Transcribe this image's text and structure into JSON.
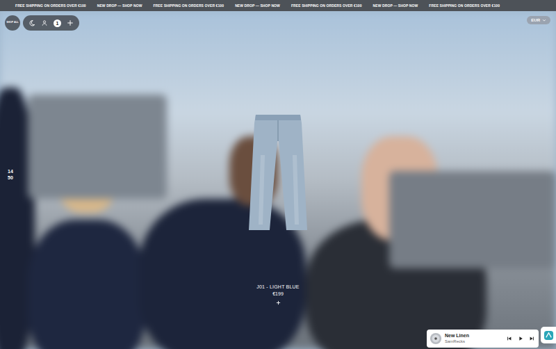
{
  "announcement_bar": {
    "items": [
      "FREE SHIPPING ON ORDERS OVER €100",
      "NEW DROP — SHOP NOW",
      "FREE SHIPPING ON ORDERS OVER €100",
      "NEW DROP — SHOP NOW",
      "FREE SHIPPING ON ORDERS OVER €100",
      "NEW DROP — SHOP NOW",
      "FREE SHIPPING ON ORDERS OVER €100"
    ]
  },
  "header": {
    "menu_button": "SHOP ALL",
    "cart_count": "1",
    "currency": "EUR"
  },
  "clock": {
    "hours": "14",
    "minutes": "50"
  },
  "product": {
    "name": "J01 - LIGHT BLUE",
    "price": "€199"
  },
  "player": {
    "title": "New Linen",
    "artist": "SamRecks",
    "playing": false
  }
}
